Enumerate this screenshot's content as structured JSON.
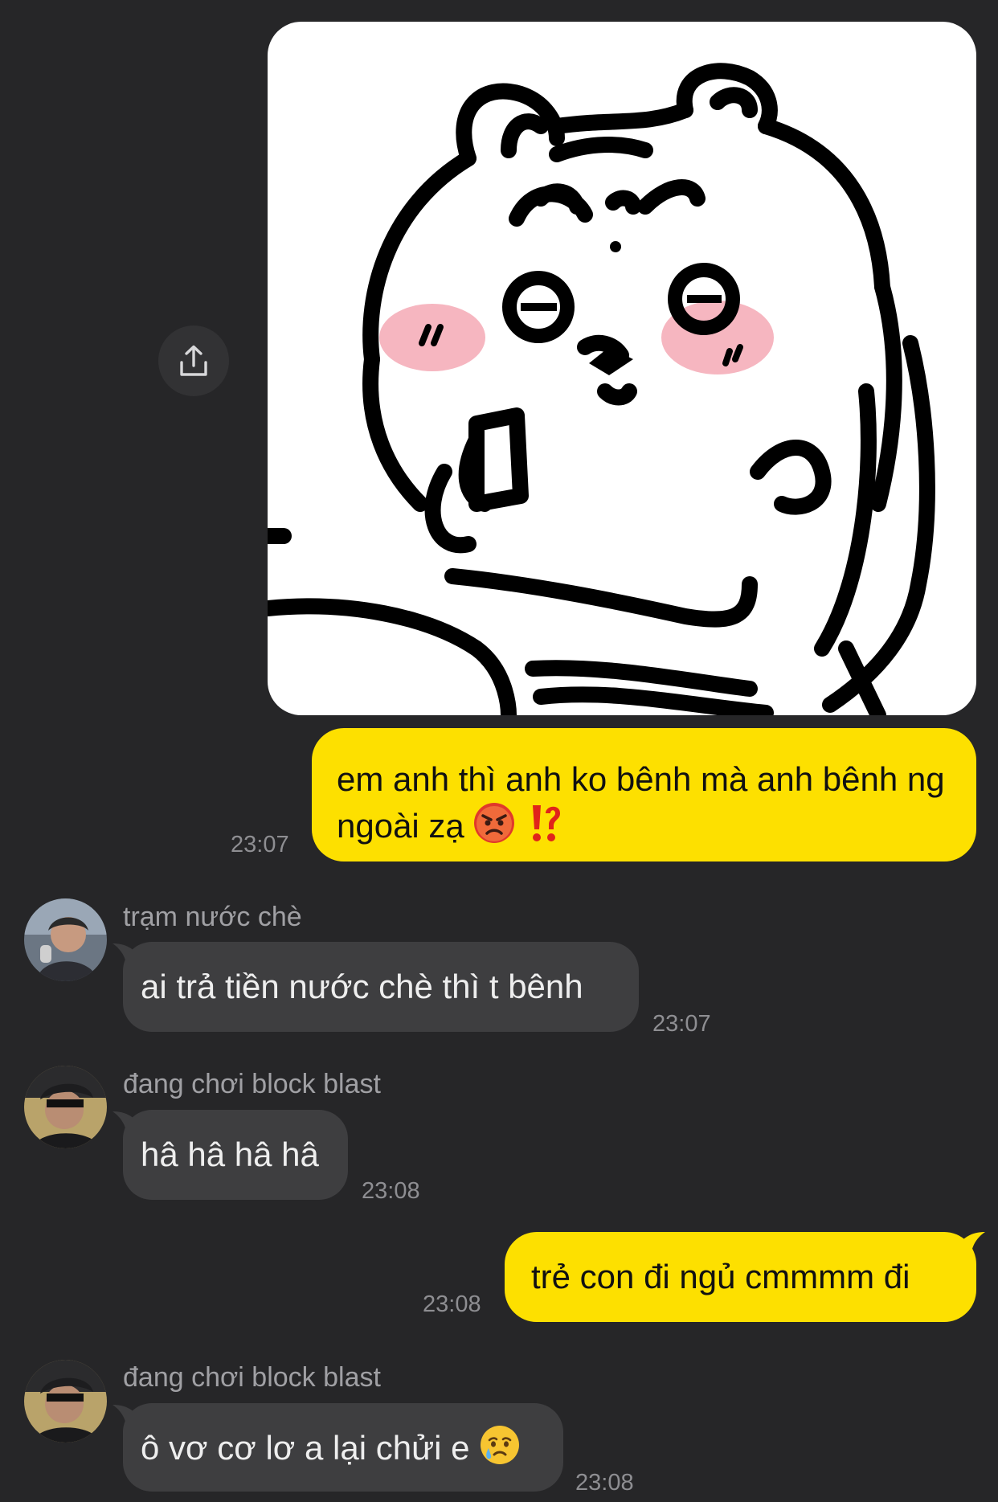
{
  "theme": {
    "background": "#262628",
    "outgoing_bubble": "#fde000",
    "incoming_bubble": "#3e3e40",
    "timestamp": "#8e8e92"
  },
  "messages": [
    {
      "id": "sticker",
      "direction": "outgoing",
      "type": "sticker",
      "sticker": "angry-hamster-holding-phone-sticker",
      "action_icon": "share-icon"
    },
    {
      "id": "m1",
      "direction": "outgoing",
      "text": "em anh thì anh ko bênh mà anh bênh ng ngoài zạ",
      "emojis": [
        "angry-face-emoji",
        "exclamation-question-mark-emoji"
      ],
      "time": "23:07"
    },
    {
      "id": "m2",
      "direction": "incoming",
      "sender": "trạm nước chè",
      "text": "ai trả tiền nước chè thì t bênh",
      "time": "23:07"
    },
    {
      "id": "m3",
      "direction": "incoming",
      "sender": "đang chơi block blast",
      "text": "hâ hâ hâ hâ",
      "time": "23:08"
    },
    {
      "id": "m4",
      "direction": "outgoing",
      "text": "trẻ con đi ngủ cmmmm đi",
      "time": "23:08"
    },
    {
      "id": "m5",
      "direction": "incoming",
      "sender": "đang chơi block blast",
      "text": "ô vơ cơ lơ a lại chửi e",
      "emojis": [
        "crying-face-emoji"
      ],
      "time": "23:08"
    }
  ]
}
